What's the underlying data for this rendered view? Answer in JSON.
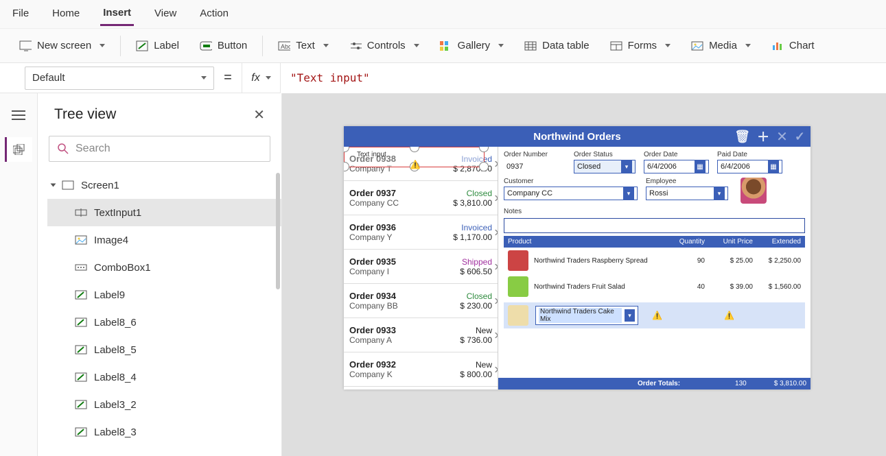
{
  "menus": {
    "file": "File",
    "home": "Home",
    "insert": "Insert",
    "view": "View",
    "action": "Action"
  },
  "ribbon": {
    "new_screen": "New screen",
    "label": "Label",
    "button": "Button",
    "text": "Text",
    "controls": "Controls",
    "gallery": "Gallery",
    "data_table": "Data table",
    "forms": "Forms",
    "media": "Media",
    "chart": "Chart"
  },
  "formula": {
    "property": "Default",
    "fx": "fx",
    "expression": "\"Text input\""
  },
  "treeview": {
    "title": "Tree view",
    "search_placeholder": "Search",
    "screen": "Screen1",
    "items": [
      "TextInput1",
      "Image4",
      "ComboBox1",
      "Label9",
      "Label8_6",
      "Label8_5",
      "Label8_4",
      "Label3_2",
      "Label8_3"
    ]
  },
  "app": {
    "title": "Northwind Orders",
    "selected_input_placeholder": "Text input",
    "orders": [
      {
        "num": "Order 0938",
        "company": "Company T",
        "status": "Invoiced",
        "status_cls": "invoiced",
        "price": "$ 2,870.00"
      },
      {
        "num": "Order 0937",
        "company": "Company CC",
        "status": "Closed",
        "status_cls": "closed",
        "price": "$ 3,810.00"
      },
      {
        "num": "Order 0936",
        "company": "Company Y",
        "status": "Invoiced",
        "status_cls": "invoiced",
        "price": "$ 1,170.00"
      },
      {
        "num": "Order 0935",
        "company": "Company I",
        "status": "Shipped",
        "status_cls": "shipped",
        "price": "$ 606.50"
      },
      {
        "num": "Order 0934",
        "company": "Company BB",
        "status": "Closed",
        "status_cls": "closed",
        "price": "$ 230.00"
      },
      {
        "num": "Order 0933",
        "company": "Company A",
        "status": "New",
        "status_cls": "new",
        "price": "$ 736.00"
      },
      {
        "num": "Order 0932",
        "company": "Company K",
        "status": "New",
        "status_cls": "new",
        "price": "$ 800.00"
      }
    ],
    "detail": {
      "labels": {
        "order_number": "Order Number",
        "order_status": "Order Status",
        "order_date": "Order Date",
        "paid_date": "Paid Date",
        "customer": "Customer",
        "employee": "Employee",
        "notes": "Notes"
      },
      "order_number": "0937",
      "order_status": "Closed",
      "order_date": "6/4/2006",
      "paid_date": "6/4/2006",
      "customer": "Company CC",
      "employee": "Rossi"
    },
    "products": {
      "head": {
        "product": "Product",
        "quantity": "Quantity",
        "unit_price": "Unit Price",
        "extended": "Extended"
      },
      "rows": [
        {
          "name": "Northwind Traders Raspberry Spread",
          "qty": "90",
          "price": "$ 25.00",
          "ext": "$ 2,250.00"
        },
        {
          "name": "Northwind Traders Fruit Salad",
          "qty": "40",
          "price": "$ 39.00",
          "ext": "$ 1,560.00"
        }
      ],
      "new_product": "Northwind Traders Cake Mix",
      "totals_label": "Order Totals:",
      "totals_qty": "130",
      "totals_ext": "$ 3,810.00"
    }
  }
}
